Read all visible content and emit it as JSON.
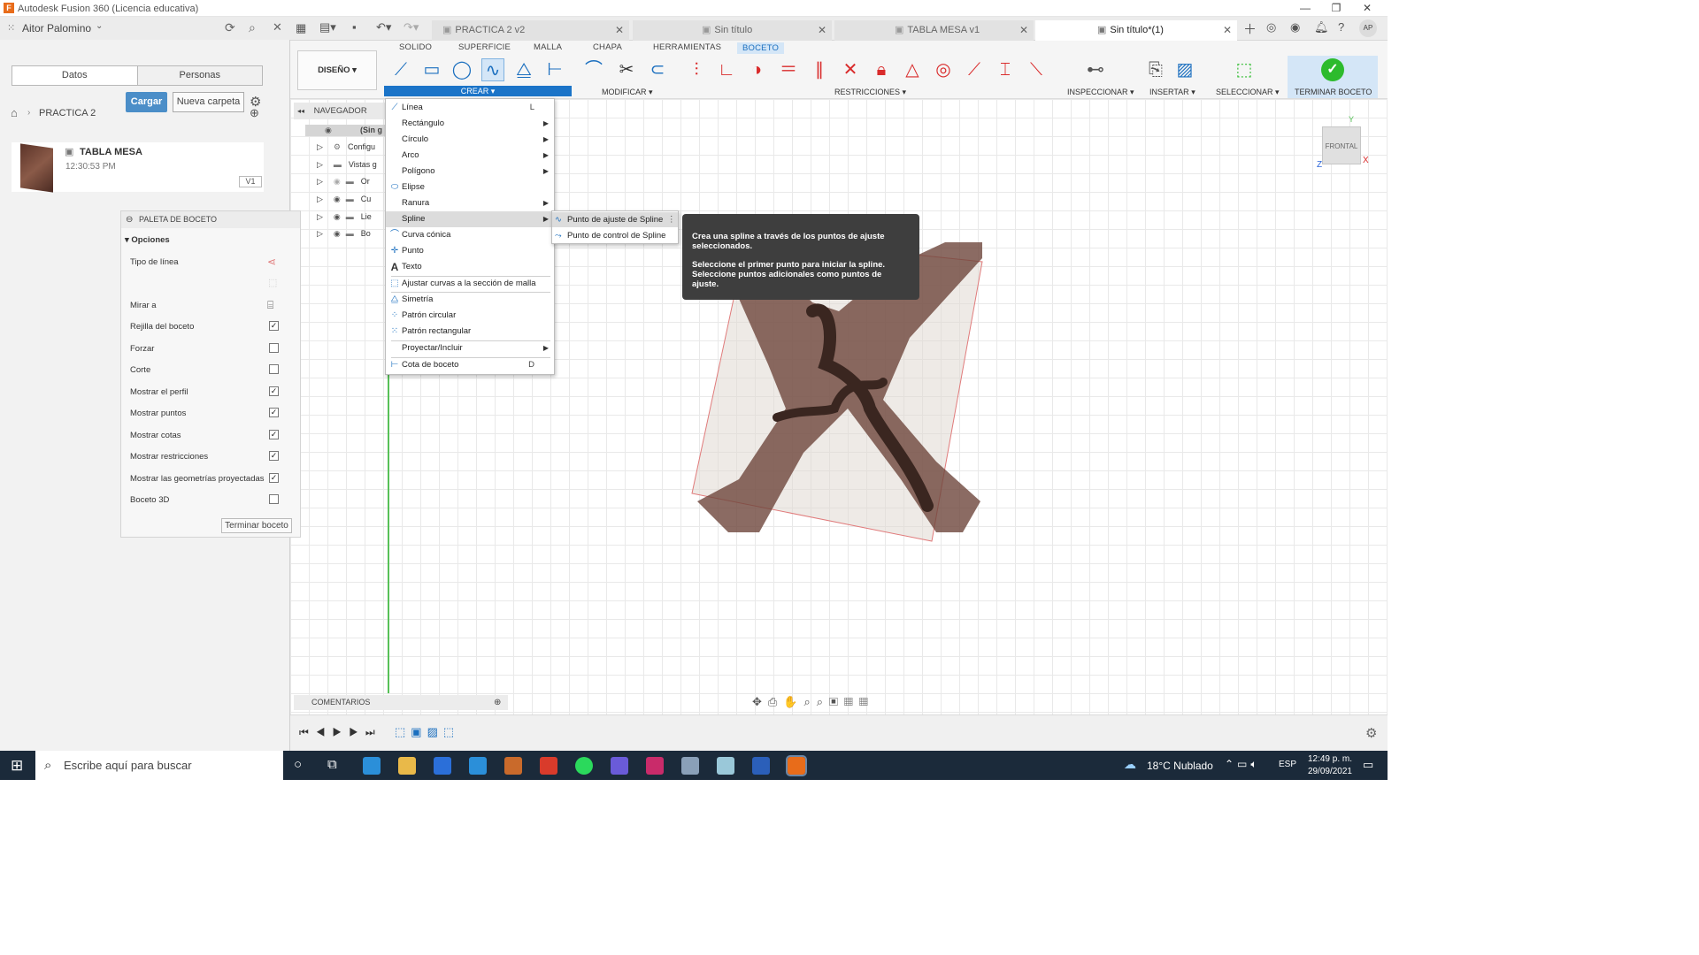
{
  "window": {
    "title": "Autodesk Fusion 360 (Licencia educativa)"
  },
  "leftpanel": {
    "user": "Aitor Palomino",
    "tab_data": "Datos",
    "tab_people": "Personas",
    "upload": "Cargar",
    "new_folder": "Nueva carpeta",
    "breadcrumb": "PRACTICA 2",
    "file_name": "TABLA MESA",
    "file_time": "12:30:53 PM",
    "file_version": "V1"
  },
  "doctabs": [
    {
      "label": "PRACTICA 2 v2"
    },
    {
      "label": "Sin título"
    },
    {
      "label": "TABLA MESA v1"
    },
    {
      "label": "Sin título*(1)"
    }
  ],
  "ribbon": {
    "workspace": "DISEÑO",
    "tabs": [
      "SOLIDO",
      "SUPERFICIE",
      "MALLA",
      "CHAPA",
      "HERRAMIENTAS",
      "BOCETO"
    ],
    "groups": {
      "create": "CREAR",
      "modify": "MODIFICAR",
      "constraints": "RESTRICCIONES",
      "inspect": "INSPECCIONAR",
      "insert": "INSERTAR",
      "select": "SELECCIONAR",
      "finish": "TERMINAR BOCETO"
    }
  },
  "navigator": {
    "title": "NAVEGADOR",
    "root": "(Sin g",
    "rows": [
      "Configu",
      "Vistas g",
      "Or",
      "Cu",
      "Lie",
      "Bo"
    ]
  },
  "palette": {
    "title": "PALETA DE BOCETO",
    "section": "Opciones",
    "options": [
      {
        "label": "Tipo de línea"
      },
      {
        "label": "Mirar a"
      },
      {
        "label": "Rejilla del boceto",
        "checked": true
      },
      {
        "label": "Forzar",
        "checked": false
      },
      {
        "label": "Corte",
        "checked": false
      },
      {
        "label": "Mostrar el perfil",
        "checked": true
      },
      {
        "label": "Mostrar puntos",
        "checked": true
      },
      {
        "label": "Mostrar cotas",
        "checked": true
      },
      {
        "label": "Mostrar restricciones",
        "checked": true
      },
      {
        "label": "Mostrar las geometrías proyectadas",
        "checked": true
      },
      {
        "label": "Boceto 3D",
        "checked": false
      }
    ],
    "finish": "Terminar boceto"
  },
  "menu": {
    "items": [
      "Línea",
      "Rectángulo",
      "Círculo",
      "Arco",
      "Polígono",
      "Elipse",
      "Ranura",
      "Spline",
      "Curva cónica",
      "Punto",
      "Texto",
      "Ajustar curvas a la sección de malla",
      "Simetría",
      "Patrón circular",
      "Patrón rectangular",
      "Proyectar/Incluir",
      "Cota de boceto"
    ],
    "shortcut_line": "L",
    "shortcut_dim": "D"
  },
  "submenu": {
    "items": [
      "Punto de ajuste de Spline",
      "Punto de control de Spline"
    ]
  },
  "tooltip": {
    "line1": "Crea una spline a través de los puntos de ajuste seleccionados.",
    "line2": "Seleccione el primer punto para iniciar la spline. Seleccione puntos adicionales como puntos de ajuste."
  },
  "viewcube": {
    "face": "FRONTAL",
    "axis_y": "Y",
    "axis_x": "X",
    "axis_z": "Z"
  },
  "comments": {
    "label": "COMENTARIOS"
  },
  "taskbar": {
    "search": "Escribe aquí para buscar",
    "weather": "18°C  Nublado",
    "lang": "ESP",
    "time": "12:49 p. m.",
    "date": "29/09/2021"
  },
  "colors": {
    "accent": "#1b74c8",
    "finish_green": "#2dbb2d",
    "wood": "#6b4032"
  }
}
